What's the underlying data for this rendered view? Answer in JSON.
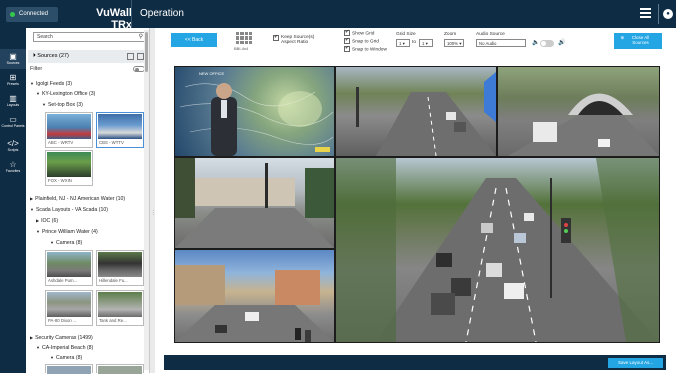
{
  "header": {
    "status": "Connected",
    "brand": "VuWall TRx",
    "title": "Operation"
  },
  "rail": [
    {
      "label": "Sources",
      "icon": "sources-icon",
      "glyph": "▣"
    },
    {
      "label": "Presets",
      "icon": "presets-icon",
      "glyph": "⊞"
    },
    {
      "label": "Layouts",
      "icon": "layouts-icon",
      "glyph": "▥"
    },
    {
      "label": "Control Panels",
      "icon": "control-panels-icon",
      "glyph": "▭"
    },
    {
      "label": "Scripts",
      "icon": "scripts-icon",
      "glyph": "</>"
    },
    {
      "label": "Favorites",
      "icon": "favorites-icon",
      "glyph": "☆"
    }
  ],
  "panel": {
    "search_placeholder": "Search",
    "sources_header": "Sources (27)",
    "filter_label": "Filter",
    "tree": [
      {
        "label": "Igolgi Feeds (3)",
        "level": 0,
        "arrow": "▼"
      },
      {
        "label": "KY-Lexington Office (3)",
        "level": 1,
        "arrow": "▼"
      },
      {
        "label": "Set-top Box (3)",
        "level": 2,
        "arrow": "▼"
      },
      {
        "label": "Plainfield, NJ - NJ American Water (10)",
        "level": 0,
        "arrow": "▶"
      },
      {
        "label": "Scada Layouts - VA Scada (10)",
        "level": 0,
        "arrow": "▼"
      },
      {
        "label": "IOC (6)",
        "level": 1,
        "arrow": "▶"
      },
      {
        "label": "Prince William Water (4)",
        "level": 1,
        "arrow": "▼"
      },
      {
        "label": "Camera (8)",
        "level": 2,
        "arrow": "▼"
      },
      {
        "label": "Security Cameras (1499)",
        "level": 0,
        "arrow": "▶"
      },
      {
        "label": "CA-Imperial Beach (8)",
        "level": 1,
        "arrow": "▼"
      },
      {
        "label": "Camera (8)",
        "level": 2,
        "arrow": "▼"
      }
    ],
    "thumbs": [
      {
        "caption": "ABC - WRTV"
      },
      {
        "caption": "CBS - WTTV"
      },
      {
        "caption": "FOX - WXIN"
      },
      {
        "caption": "Ashdale Pum..."
      },
      {
        "caption": "Hillendale Fu..."
      },
      {
        "caption": "PA-80 Dixon ..."
      },
      {
        "caption": "Tank and Re..."
      }
    ]
  },
  "toolbar": {
    "back": "<< Back",
    "layout_name": "BBI-4x4",
    "keep_aspect": "Keep Source(s) Aspect Ratio",
    "show_grid": "Show Grid",
    "snap_grid": "Snap to Grid",
    "snap_window": "Snap to Window",
    "grid_size_label": "Grid Size",
    "grid_x": "1",
    "grid_to": "to",
    "grid_y": "1",
    "zoom_label": "Zoom",
    "zoom_value": "100%",
    "audio_label": "Audio Source",
    "audio_value": "No Audio",
    "close_all": "Close All Sources"
  },
  "canvas": {
    "weather_tag": "NEW OFFICE"
  },
  "footer": {
    "save": "Save Layout As..."
  }
}
